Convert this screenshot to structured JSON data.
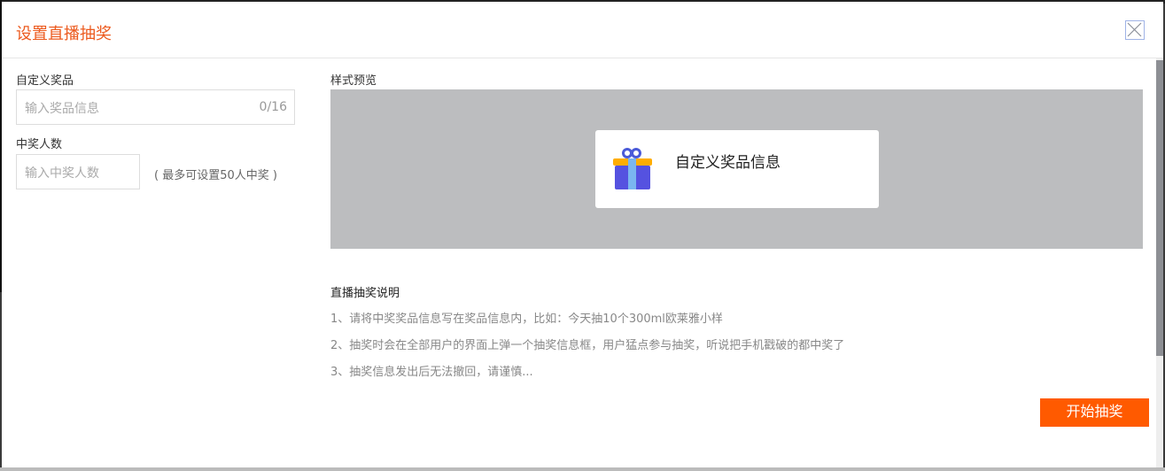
{
  "dialog": {
    "title": "设置直播抽奖",
    "close_icon": "close-icon"
  },
  "form": {
    "prize_label": "自定义奖品",
    "prize_placeholder": "输入奖品信息",
    "prize_counter": "0/16",
    "winners_label": "中奖人数",
    "winners_placeholder": "输入中奖人数",
    "winners_hint": "( 最多可设置50人中奖 )"
  },
  "preview": {
    "label": "样式预览",
    "card_text": "自定义奖品信息",
    "icon": "gift-icon"
  },
  "notes": {
    "title": "直播抽奖说明",
    "items": [
      "1、请将中奖奖品信息写在奖品信息内，比如：今天抽10个300ml欧莱雅小样",
      "2、抽奖时会在全部用户的界面上弹一个抽奖信息框，用户猛点参与抽奖，听说把手机戳破的都中奖了",
      "3、抽奖信息发出后无法撤回，请谨慎..."
    ]
  },
  "actions": {
    "start_label": "开始抽奖"
  },
  "colors": {
    "accent": "#ff5a00",
    "title": "#ec5a1e",
    "preview_bg": "#bcbdbf"
  }
}
